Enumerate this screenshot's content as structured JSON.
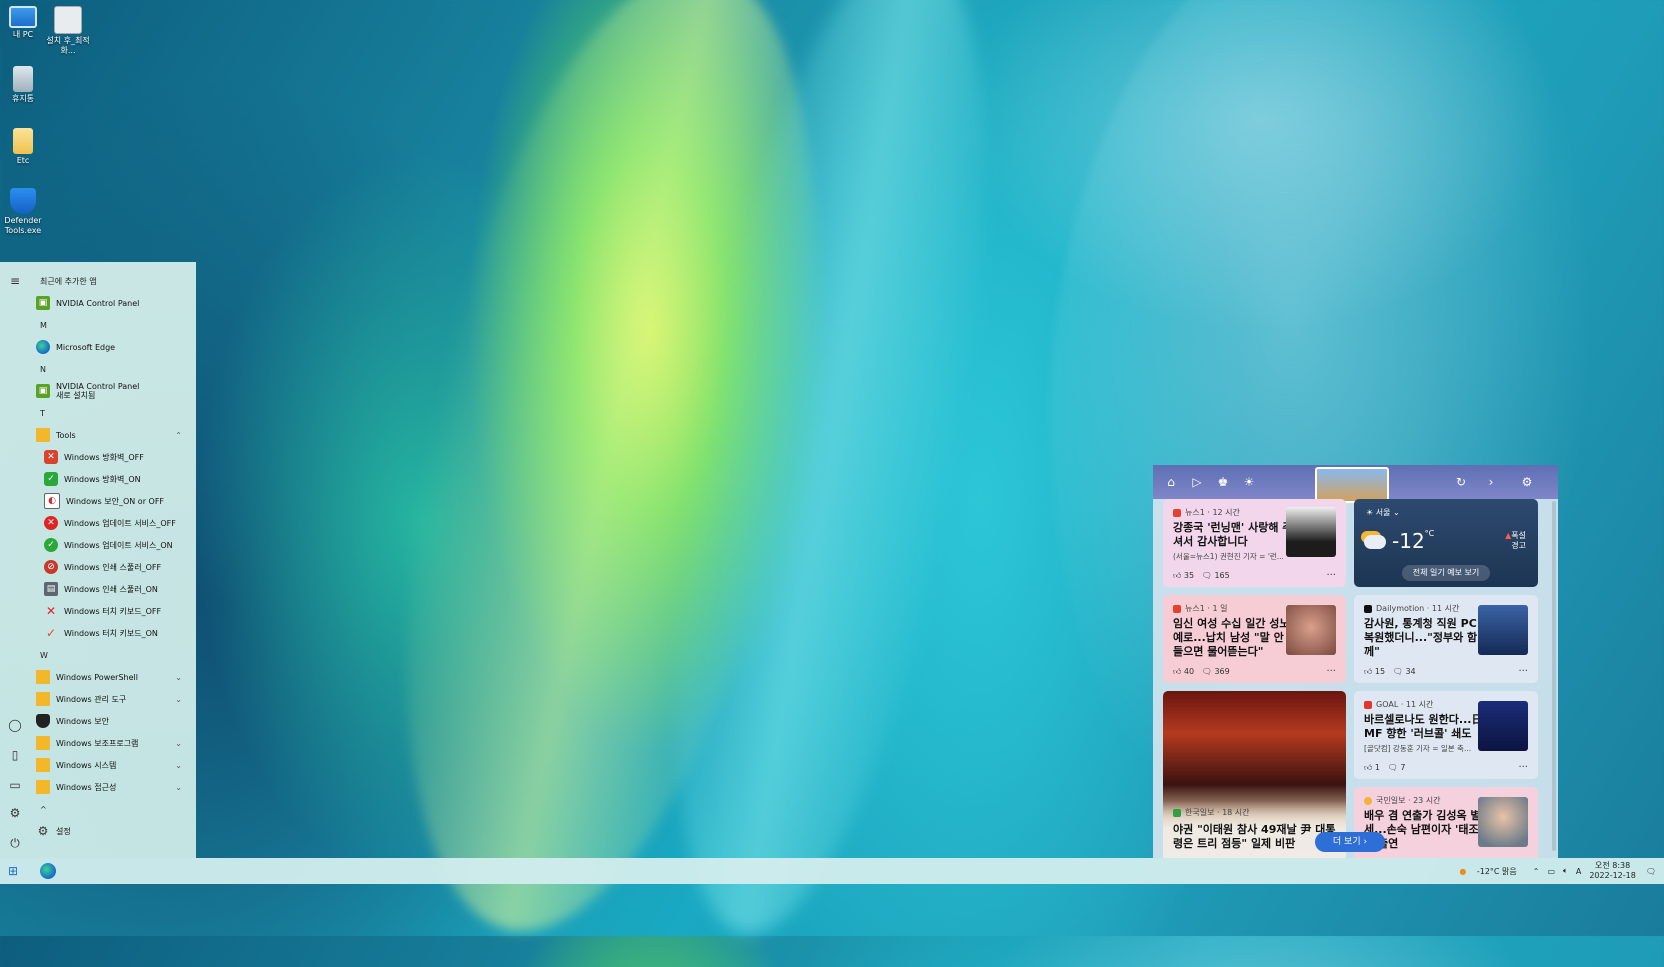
{
  "desktop": {
    "icons": [
      {
        "label": "내 PC",
        "icon": "pc-icon"
      },
      {
        "label": "설치 후_최적화...",
        "icon": "settings-shortcut-icon"
      },
      {
        "label": "휴지통",
        "icon": "recycle-bin-icon"
      },
      {
        "label": "Etc",
        "icon": "folder-icon"
      },
      {
        "label": "Defender Tools.exe",
        "icon": "shield-icon"
      }
    ]
  },
  "start_menu": {
    "recent_header": "최근에 추가한 앱",
    "recent_app": "NVIDIA Control Panel",
    "section_m": "M",
    "edge_label": "Microsoft Edge",
    "section_n": "N",
    "nvidia_new_line1": "NVIDIA Control Panel",
    "nvidia_new_line2": "새로 설치됨",
    "section_t": "T",
    "tools_folder": "Tools",
    "tools_items": [
      "Windows 방화벽_OFF",
      "Windows 방화벽_ON",
      "Windows 보안_ON or OFF",
      "Windows 업데이트 서비스_OFF",
      "Windows 업데이트 서비스_ON",
      "Windows 인쇄 스풀러_OFF",
      "Windows 인쇄 스풀러_ON",
      "Windows 터치 키보드_OFF",
      "Windows 터치 키보드_ON"
    ],
    "section_w": "W",
    "w_items": [
      "Windows PowerShell",
      "Windows 관리 도구",
      "Windows 보안",
      "Windows 보조프로그램",
      "Windows 시스템",
      "Windows 접근성"
    ],
    "caret_up": "^",
    "settings_label": "설정"
  },
  "widgets": {
    "cards": [
      {
        "source": "뉴스1 · 12 시간",
        "title": "강종국 '런닝맨' 사랑해 주셔서 감사합니다",
        "snippet": "(서울=뉴스1) 권현진 기자 = '런...",
        "likes": "35",
        "comments": "165"
      },
      {
        "source": "뉴스1 · 1 일",
        "title": "임신 여성 수십 일간 성노예로...납치 남성 \"말 안 들으면 물어뜯는다\"",
        "snippet": "",
        "likes": "40",
        "comments": "369"
      },
      {
        "source": "Dailymotion · 11 시간",
        "title": "감사원, 통계청 직원 PC 복원했더니...\"정부와 함께\"",
        "snippet": "",
        "likes": "15",
        "comments": "34"
      },
      {
        "source": "GOAL · 11 시간",
        "title": "바르셀로나도 원한다...日 MF 향한 '러브콜' 쇄도",
        "snippet": "[골닷컴] 강동훈 기자 = 일본 축...",
        "likes": "1",
        "comments": "7"
      },
      {
        "source": "한국일보 · 18 시간",
        "title": "야권 \"이태원 참사 49재날 尹 대통령은 트리 점등\" 일제 비판",
        "snippet": "",
        "likes": "",
        "comments": ""
      },
      {
        "source": "국민일보 · 23 시간",
        "title": "배우 겸 연출가 김성옥 별세...손숙 남편이자 '태조' 등 출연",
        "snippet": "",
        "likes": "",
        "comments": ""
      }
    ],
    "weather": {
      "location": "서울",
      "temp": "-12",
      "unit": "°C",
      "alert_line1": "폭설",
      "alert_line2": "경고",
      "forecast_button": "전체 일기 예보 보기"
    },
    "more_button": "더 보기"
  },
  "taskbar": {
    "weather": "-12°C 맑음",
    "ime": "A",
    "time": "오전 8:38",
    "date": "2022-12-18"
  }
}
